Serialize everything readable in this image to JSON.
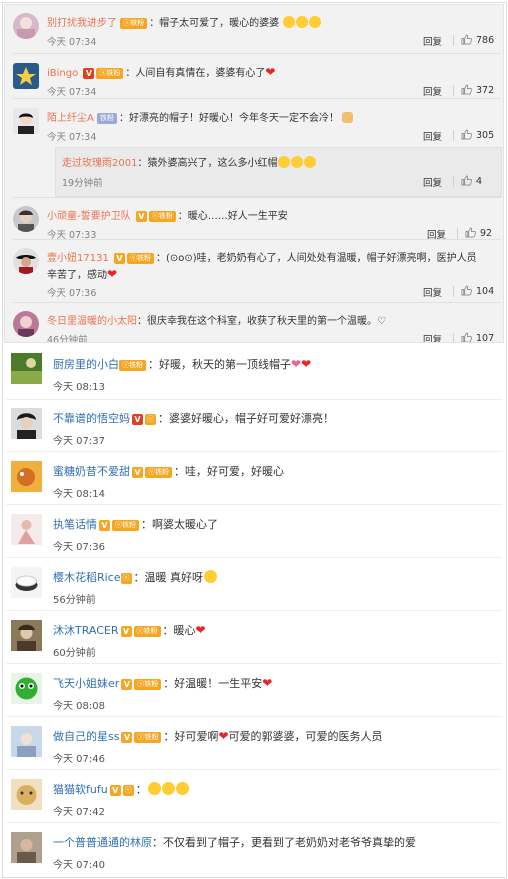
{
  "top_comments": [
    {
      "user": "别打扰我进步了",
      "badge": "fan",
      "text": "：帽子太可爱了，暖心的婆婆",
      "emojis": 3,
      "heart": false,
      "time": "今天 07:34",
      "reply": "回复",
      "likes": "786",
      "avatar": "#c89ab0"
    },
    {
      "user": "iBingo",
      "badge": "vfan",
      "text": "：人间自有真情在，婆婆有心了",
      "emojis": 0,
      "heart": true,
      "time": "今天 07:34",
      "reply": "回复",
      "likes": "372",
      "avatar": "#3a6a3a"
    },
    {
      "user": "陌上纤尘A",
      "badge": "tag",
      "tag": "铁粉",
      "text": "：好漂亮的帽子！好暖心！今年冬天一定不会冷！",
      "emojis": 0,
      "heart": false,
      "time": "今天 07:34",
      "reply": "回复",
      "likes": "305",
      "avatar": "#222222"
    },
    {
      "user": "小顽童-誓要护卫队",
      "badge": "vfan",
      "text": "：暖心……好人一生平安",
      "emojis": 0,
      "heart": false,
      "time": "今天 07:33",
      "reply": "回复",
      "likes": "92",
      "avatar": "#5a5a5a"
    },
    {
      "user": "壹小妞17131",
      "badge": "vfan",
      "text": "：(⊙o⊙)哇，老奶奶有心了，人间处处有温暖，帽子好漂亮啊，医护人员",
      "text2": "辛苦了，感动",
      "emojis": 0,
      "heart": true,
      "time": "今天 07:36",
      "reply": "回复",
      "likes": "104",
      "avatar": "#7a1a1a"
    },
    {
      "user": "冬日里温暖的小太阳",
      "badge": "none",
      "text": "：很庆幸我在这个科室，收获了秋天里的第一个温暖。♡",
      "emojis": 0,
      "heart": false,
      "time": "46分钟前",
      "reply": "回复",
      "likes": "107",
      "avatar": "#8a4a6a"
    }
  ],
  "sub_reply": {
    "user": "走过玫瑰雨2001",
    "text": "：猿外婆高兴了，这么多小红帽",
    "time": "19分钟前",
    "reply": "回复",
    "likes": "4"
  },
  "bottom_comments": [
    {
      "user": "厨房里的小白",
      "badge": "fan",
      "text": "：好暖，秋天的第一顶线帽子",
      "emoji": "heart2",
      "time": "今天 08:13",
      "avatar": "#6a8a3a"
    },
    {
      "user": "不靠谱的悟空妈",
      "badge": "vfan-red",
      "text": "：婆婆好暖心，帽子好可爱好漂亮！",
      "emoji": "none",
      "time": "今天 07:37",
      "avatar": "#333333"
    },
    {
      "user": "蜜糖奶昔不爱甜",
      "badge": "vfan",
      "text": "：哇，好可爱，好暖心",
      "emoji": "none",
      "time": "今天 08:14",
      "avatar": "#d09030"
    },
    {
      "user": "执笔话情",
      "badge": "vfan",
      "text": "：啊婆太暖心了",
      "emoji": "none",
      "time": "今天 07:36",
      "avatar": "#e8c8b8"
    },
    {
      "user": "樱木花稻Rice",
      "badge": "fan-only",
      "text": "：温暖 真好呀",
      "emoji": "laugh",
      "time": "56分钟前",
      "avatar": "#eeeeee"
    },
    {
      "user": "沐沐TRACER",
      "badge": "vfan",
      "text": "：暖心",
      "emoji": "heart",
      "time": "60分钟前",
      "avatar": "#7a6a4a"
    },
    {
      "user": "飞天小姐妹er",
      "badge": "vfan",
      "text": "：好温暖！一生平安",
      "emoji": "heart",
      "time": "今天 08:08",
      "avatar": "#3aaa3a"
    },
    {
      "user": "做自己的星ss",
      "badge": "vfan",
      "text": "：好可爱啊",
      "text2": "可爱的郭婆婆，可爱的医务人员",
      "emoji": "heart",
      "time": "今天 07:46",
      "avatar": "#9ab0c8"
    },
    {
      "user": "猫猫软fufu",
      "badge": "v-crown",
      "text": "：",
      "emoji": "kiss3",
      "time": "今天 07:42",
      "avatar": "#c8a050"
    },
    {
      "user": "一个普普通通的林原",
      "badge": "none",
      "text": "：不仅看到了帽子，更看到了老奶奶对老爷爷真挚的爱",
      "emoji": "none",
      "time": "今天 07:40",
      "avatar": "#8a7a6a"
    }
  ],
  "labels": {
    "fan": "铁粉",
    "v": "V"
  }
}
